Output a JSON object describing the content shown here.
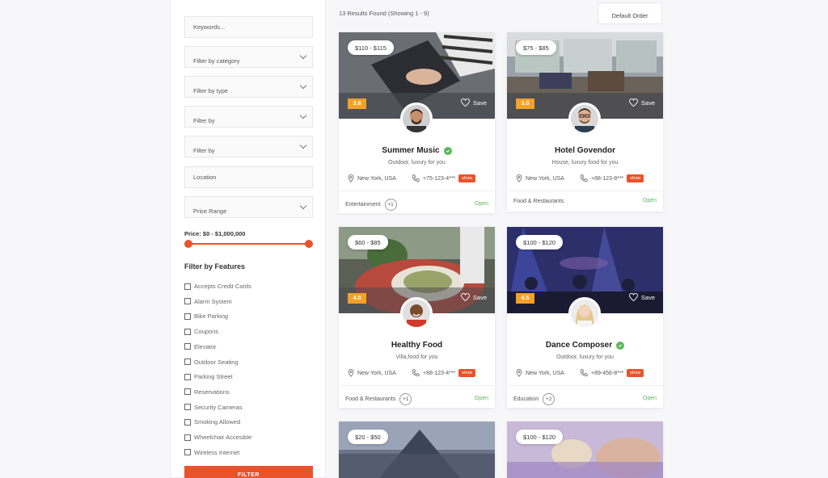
{
  "sidebar": {
    "keywords_placeholder": "Keywords...",
    "category": "Filter by category",
    "type": "Filter by type",
    "filter1": "Filter by",
    "filter2": "Filter by",
    "location_placeholder": "Location",
    "price_range": "Price Range",
    "price_label": "Price: $0 - $1,000,000",
    "features_title": "Filter by Features",
    "features": [
      "Accepts Credit Cards",
      "Alarm System",
      "Bike Parking",
      "Coupons",
      "Elevator",
      "Outdoor Seating",
      "Parking Street",
      "Reservations",
      "Security Cameras",
      "Smoking Allowed",
      "Wheelchair Accesible",
      "Wireless Internet"
    ],
    "filter_button": "FILTER",
    "accent": "#e8532b"
  },
  "topbar": {
    "results": "13 Results Found (Showing 1 - 9)",
    "order": "Default Order"
  },
  "cards": [
    {
      "price": "$110 - $115",
      "rating": "3.8",
      "save": "Save",
      "title": "Summer Music",
      "sub": "Outdoor, luxury for you",
      "location": "New York, USA",
      "phone": "+75-123-4***",
      "show": "show",
      "category": "Entertainment",
      "extra": "+1",
      "status": "Open"
    },
    {
      "price": "$75 - $85",
      "rating": "3.0",
      "save": "Save",
      "title": "Hotel Govendor",
      "sub": "House, luxury food for you",
      "location": "New York, USA",
      "phone": "+88-123-8***",
      "show": "show",
      "category": "Food & Restaurants",
      "extra": "",
      "status": "Open"
    },
    {
      "price": "$60 - $85",
      "rating": "4.0",
      "save": "Save",
      "title": "Healthy Food",
      "sub": "Villa,food for you",
      "location": "New York, USA",
      "phone": "+88-123-4***",
      "show": "show",
      "category": "Food & Restaurants",
      "extra": "+1",
      "status": "Open"
    },
    {
      "price": "$100 - $120",
      "rating": "4.5",
      "save": "Save",
      "title": "Dance Composer",
      "sub": "Outdoor, luxury for you",
      "location": "New York, USA",
      "phone": "+89-456-8***",
      "show": "show",
      "category": "Education",
      "extra": "+2",
      "status": "Open"
    },
    {
      "price": "$20 - $50"
    },
    {
      "price": "$100 - $120"
    }
  ]
}
